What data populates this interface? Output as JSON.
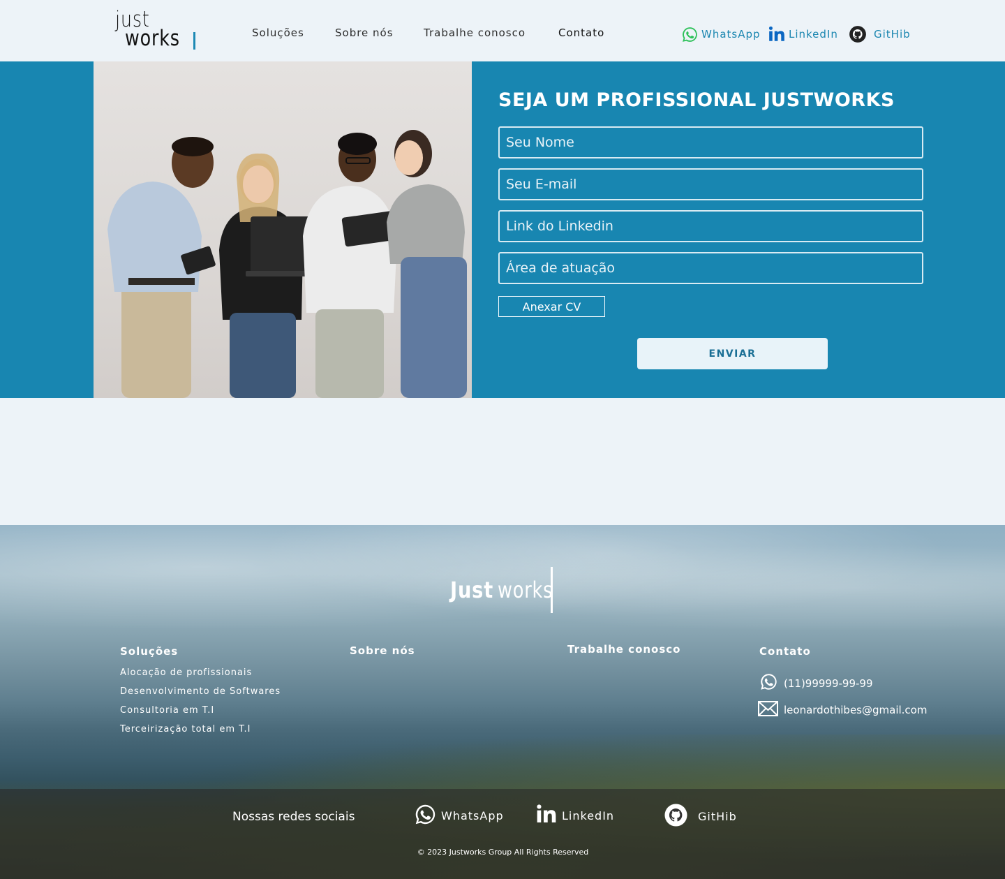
{
  "header": {
    "logo_line1": "just",
    "logo_line2": "works",
    "nav": [
      "Soluções",
      "Sobre nós",
      "Trabalhe conosco",
      "Contato"
    ],
    "social": [
      {
        "label": "WhatsApp",
        "icon": "whatsapp-icon"
      },
      {
        "label": "LinkedIn",
        "icon": "linkedin-icon"
      },
      {
        "label": "GitHib",
        "icon": "github-icon"
      }
    ]
  },
  "form": {
    "title": "SEJA UM PROFISSIONAL JUSTWORKS",
    "name_placeholder": "Seu Nome",
    "email_placeholder": "Seu E-mail",
    "linkedin_placeholder": "Link do Linkedin",
    "area_placeholder": "Área de atuação",
    "attach_label": "Anexar CV",
    "submit_label": "ENVIAR"
  },
  "footer": {
    "logo_bold": "Just",
    "logo_light": "works",
    "columns": {
      "solucoes": {
        "title": "Soluções",
        "items": [
          "Alocação de profissionais",
          "Desenvolvimento de Softwares",
          "Consultoria em T.I",
          "Terceirização total em T.I"
        ]
      },
      "sobre": {
        "title": "Sobre nós"
      },
      "trabalhe": {
        "title": "Trabalhe conosco"
      },
      "contato": {
        "title": "Contato",
        "phone": "(11)99999-99-99",
        "email": "leonardothibes@gmail.com"
      }
    },
    "social_label": "Nossas redes sociais",
    "social": [
      {
        "label": "WhatsApp",
        "icon": "whatsapp-icon"
      },
      {
        "label": "LinkedIn",
        "icon": "linkedin-icon"
      },
      {
        "label": "GitHib",
        "icon": "github-icon"
      }
    ],
    "copyright": "© 2023 Justworks Group  All Rights Reserved"
  },
  "colors": {
    "brand_blue": "#1886b1",
    "link_blue": "#1a86b0",
    "page_bg": "#edf3f8"
  }
}
